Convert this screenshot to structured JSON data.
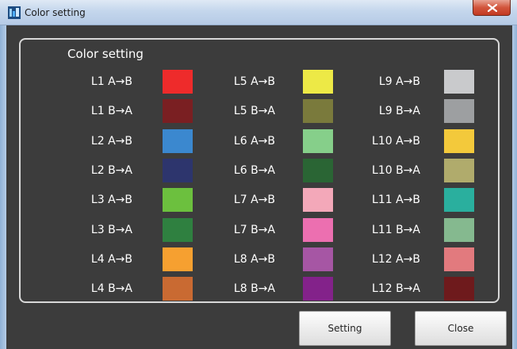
{
  "window": {
    "title": "Color setting"
  },
  "panel": {
    "title": "Color setting"
  },
  "columns": [
    {
      "items": [
        {
          "label": "L1 A→B",
          "color": "#ee2b2b"
        },
        {
          "label": "L1 B→A",
          "color": "#7a1f22"
        },
        {
          "label": "L2 A→B",
          "color": "#3b88cf"
        },
        {
          "label": "L2 B→A",
          "color": "#2d356d"
        },
        {
          "label": "L3 A→B",
          "color": "#6cc03e"
        },
        {
          "label": "L3 B→A",
          "color": "#2f8040"
        },
        {
          "label": "L4 A→B",
          "color": "#f6a030"
        },
        {
          "label": "L4 B→A",
          "color": "#c96a32"
        }
      ]
    },
    {
      "items": [
        {
          "label": "L5 A→B",
          "color": "#ede946"
        },
        {
          "label": "L5 B→A",
          "color": "#7a7a3c"
        },
        {
          "label": "L6 A→B",
          "color": "#86cf8a"
        },
        {
          "label": "L6 B→A",
          "color": "#2a6534"
        },
        {
          "label": "L7 A→B",
          "color": "#f3a8b9"
        },
        {
          "label": "L7 B→A",
          "color": "#ec6fb0"
        },
        {
          "label": "L8 A→B",
          "color": "#a656a4"
        },
        {
          "label": "L8 B→A",
          "color": "#83228a"
        }
      ]
    },
    {
      "items": [
        {
          "label": "L9 A→B",
          "color": "#c9cacc"
        },
        {
          "label": "L9 B→A",
          "color": "#9d9fa1"
        },
        {
          "label": "L10 A→B",
          "color": "#f3c93b"
        },
        {
          "label": "L10 B→A",
          "color": "#b0ab6c"
        },
        {
          "label": "L11 A→B",
          "color": "#2aaf9e"
        },
        {
          "label": "L11 B→A",
          "color": "#85b98f"
        },
        {
          "label": "L12 A→B",
          "color": "#e27a7e"
        },
        {
          "label": "L12 B→A",
          "color": "#6e1a1c"
        }
      ]
    }
  ],
  "buttons": {
    "setting": "Setting",
    "close": "Close"
  }
}
